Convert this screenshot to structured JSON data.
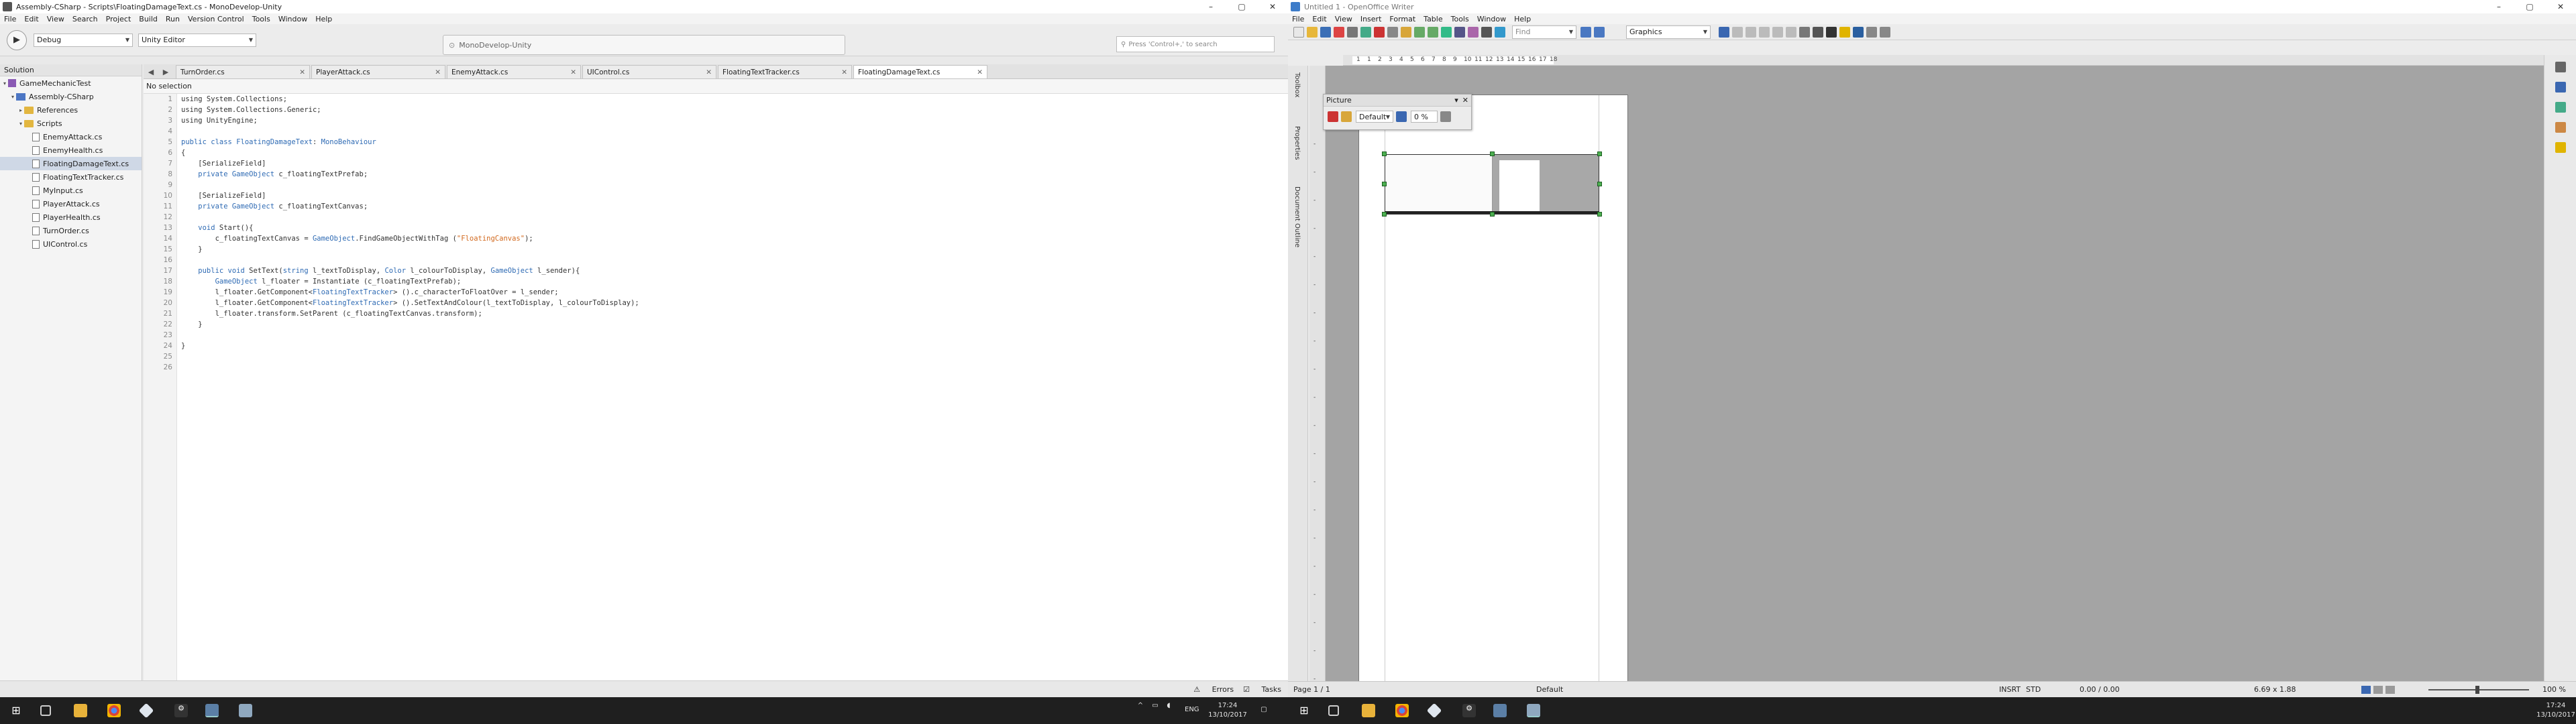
{
  "monodevelop": {
    "title": "Assembly-CSharp - Scripts\\FloatingDamageText.cs - MonoDevelop-Unity",
    "menu": [
      "File",
      "Edit",
      "View",
      "Search",
      "Project",
      "Build",
      "Run",
      "Version Control",
      "Tools",
      "Window",
      "Help"
    ],
    "config": "Debug",
    "target": "Unity Editor",
    "status": "MonoDevelop-Unity",
    "search_placeholder": "Press 'Control+,' to search",
    "solution_header": "Solution",
    "tree": [
      {
        "label": "GameMechanicTest",
        "kind": "solution",
        "indent": 0,
        "expand": "▾"
      },
      {
        "label": "Assembly-CSharp",
        "kind": "project",
        "indent": 1,
        "expand": "▾"
      },
      {
        "label": "References",
        "kind": "folder",
        "indent": 2,
        "expand": "▸"
      },
      {
        "label": "Scripts",
        "kind": "folder",
        "indent": 2,
        "expand": "▾"
      },
      {
        "label": "EnemyAttack.cs",
        "kind": "file",
        "indent": 3,
        "expand": ""
      },
      {
        "label": "EnemyHealth.cs",
        "kind": "file",
        "indent": 3,
        "expand": ""
      },
      {
        "label": "FloatingDamageText.cs",
        "kind": "file",
        "indent": 3,
        "expand": "",
        "selected": true
      },
      {
        "label": "FloatingTextTracker.cs",
        "kind": "file",
        "indent": 3,
        "expand": ""
      },
      {
        "label": "MyInput.cs",
        "kind": "file",
        "indent": 3,
        "expand": ""
      },
      {
        "label": "PlayerAttack.cs",
        "kind": "file",
        "indent": 3,
        "expand": ""
      },
      {
        "label": "PlayerHealth.cs",
        "kind": "file",
        "indent": 3,
        "expand": ""
      },
      {
        "label": "TurnOrder.cs",
        "kind": "file",
        "indent": 3,
        "expand": ""
      },
      {
        "label": "UIControl.cs",
        "kind": "file",
        "indent": 3,
        "expand": ""
      }
    ],
    "tabs": [
      "TurnOrder.cs",
      "PlayerAttack.cs",
      "EnemyAttack.cs",
      "UIControl.cs",
      "FloatingTextTracker.cs",
      "FloatingDamageText.cs"
    ],
    "active_tab": 5,
    "breadcrumb": "No selection",
    "code": [
      [
        {
          "t": "using System.Collections;"
        }
      ],
      [
        {
          "t": "using System.Collections.Generic;"
        }
      ],
      [
        {
          "t": "using UnityEngine;"
        }
      ],
      [
        {
          "t": ""
        }
      ],
      [
        {
          "t": "public class ",
          "c": "kw"
        },
        {
          "t": "FloatingDamageText",
          "c": "ty"
        },
        {
          "t": ": "
        },
        {
          "t": "MonoBehaviour",
          "c": "ty"
        }
      ],
      [
        {
          "t": "{"
        }
      ],
      [
        {
          "t": "    [SerializeField]"
        }
      ],
      [
        {
          "t": "    private ",
          "c": "kw"
        },
        {
          "t": "GameObject",
          "c": "ty"
        },
        {
          "t": " c_floatingTextPrefab;"
        }
      ],
      [
        {
          "t": ""
        }
      ],
      [
        {
          "t": "    [SerializeField]"
        }
      ],
      [
        {
          "t": "    private ",
          "c": "kw"
        },
        {
          "t": "GameObject",
          "c": "ty"
        },
        {
          "t": " c_floatingTextCanvas;"
        }
      ],
      [
        {
          "t": ""
        }
      ],
      [
        {
          "t": "    void ",
          "c": "kw"
        },
        {
          "t": "Start(){"
        }
      ],
      [
        {
          "t": "        c_floatingTextCanvas = "
        },
        {
          "t": "GameObject",
          "c": "ty"
        },
        {
          "t": ".FindGameObjectWithTag ("
        },
        {
          "t": "\"FloatingCanvas\"",
          "c": "st"
        },
        {
          "t": ");"
        }
      ],
      [
        {
          "t": "    }"
        }
      ],
      [
        {
          "t": ""
        }
      ],
      [
        {
          "t": "    public void ",
          "c": "kw"
        },
        {
          "t": "SetText("
        },
        {
          "t": "string",
          "c": "kw"
        },
        {
          "t": " l_textToDisplay, "
        },
        {
          "t": "Color",
          "c": "ty"
        },
        {
          "t": " l_colourToDisplay, "
        },
        {
          "t": "GameObject",
          "c": "ty"
        },
        {
          "t": " l_sender){"
        }
      ],
      [
        {
          "t": "        "
        },
        {
          "t": "GameObject",
          "c": "ty"
        },
        {
          "t": " l_floater = Instantiate (c_floatingTextPrefab);"
        }
      ],
      [
        {
          "t": "        l_floater.GetComponent<"
        },
        {
          "t": "FloatingTextTracker",
          "c": "ty"
        },
        {
          "t": "> ().c_characterToFloatOver = l_sender;"
        }
      ],
      [
        {
          "t": "        l_floater.GetComponent<"
        },
        {
          "t": "FloatingTextTracker",
          "c": "ty"
        },
        {
          "t": "> ().SetTextAndColour(l_textToDisplay, l_colourToDisplay);"
        }
      ],
      [
        {
          "t": "        l_floater.transform.SetParent (c_floatingTextCanvas.transform);"
        }
      ],
      [
        {
          "t": "    }"
        }
      ],
      [
        {
          "t": ""
        }
      ],
      [
        {
          "t": "}"
        }
      ],
      [
        {
          "t": ""
        }
      ],
      [
        {
          "t": ""
        }
      ]
    ],
    "bottom": [
      "Errors",
      "Tasks"
    ]
  },
  "writer": {
    "title": "Untitled 1 - OpenOffice Writer",
    "menu": [
      "File",
      "Edit",
      "View",
      "Insert",
      "Format",
      "Table",
      "Tools",
      "Window",
      "Help"
    ],
    "find_placeholder": "Find",
    "font_name": "Graphics",
    "ruler_ticks": [
      "1",
      "1",
      "2",
      "3",
      "4",
      "5",
      "6",
      "7",
      "8",
      "9",
      "10",
      "11",
      "12",
      "13",
      "14",
      "15",
      "16",
      "17",
      "18"
    ],
    "sidebar_labels": [
      "Toolbox",
      "Properties",
      "Document Outline"
    ],
    "picture_bar": {
      "title": "Picture",
      "mode": "Default",
      "transparency": "0 %"
    },
    "status": {
      "page": "Page 1 / 1",
      "style": "Default",
      "insrt": "INSRT",
      "std": "STD",
      "pos": "0.00 / 0.00",
      "size": "6.69 x 1.88",
      "zoom": "100 %"
    }
  },
  "taskbar": {
    "left": {
      "lang": "ENG",
      "time": "17:24",
      "date": "13/10/2017"
    },
    "right": {
      "time": "17:24",
      "date": "13/10/2017"
    }
  },
  "colors": {
    "accent": "#2f6bb4",
    "string": "#d2691e",
    "handle": "#4caf50"
  }
}
